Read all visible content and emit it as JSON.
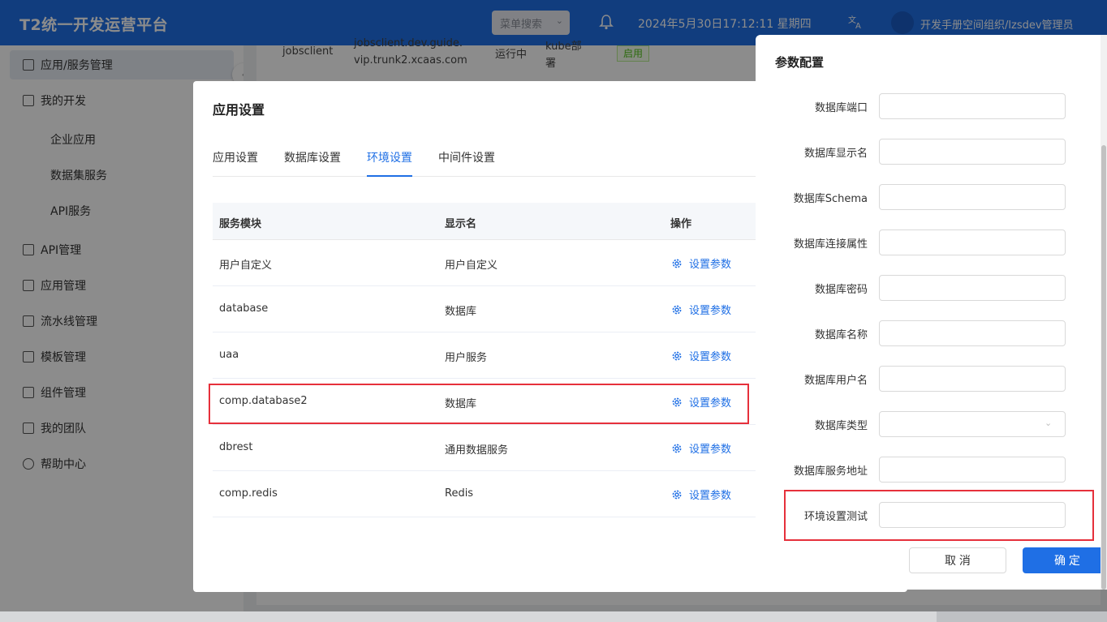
{
  "header": {
    "brand": "T2统一开发运营平台",
    "menu_search": "菜单搜索",
    "datetime": "2024年5月30日17:12:11 星期四",
    "user": "开发手册空间组织/lzsdev管理员"
  },
  "sidebar": {
    "items": [
      {
        "label": "应用/服务管理"
      },
      {
        "label": "我的开发"
      },
      {
        "label": "企业应用"
      },
      {
        "label": "数据集服务"
      },
      {
        "label": "API服务"
      },
      {
        "label": "API管理"
      },
      {
        "label": "应用管理"
      },
      {
        "label": "流水线管理"
      },
      {
        "label": "模板管理"
      },
      {
        "label": "组件管理"
      },
      {
        "label": "我的团队"
      },
      {
        "label": "帮助中心"
      }
    ]
  },
  "background_row": {
    "name": "jobsclient",
    "domain_line1": "jobsclient.dev.guide.",
    "domain_line2": "vip.trunk2.xcaas.com",
    "state": "运行中",
    "deploy_line1": "kube部",
    "deploy_line2": "署",
    "status": "启用"
  },
  "app_dialog": {
    "title": "应用设置",
    "tabs": [
      "应用设置",
      "数据库设置",
      "环境设置",
      "中间件设置"
    ],
    "active_tab": "环境设置",
    "columns": [
      "服务模块",
      "显示名",
      "操作"
    ],
    "rows": [
      {
        "module": "用户自定义",
        "display": "用户自定义",
        "action": "设置参数"
      },
      {
        "module": "database",
        "display": "数据库",
        "action": "设置参数"
      },
      {
        "module": "uaa",
        "display": "用户服务",
        "action": "设置参数"
      },
      {
        "module": "comp.database2",
        "display": "数据库",
        "action": "设置参数"
      },
      {
        "module": "dbrest",
        "display": "通用数据服务",
        "action": "设置参数"
      },
      {
        "module": "comp.redis",
        "display": "Redis",
        "action": "设置参数"
      }
    ]
  },
  "drawer": {
    "title": "参数配置",
    "fields": [
      {
        "label": "数据库端口",
        "value": ""
      },
      {
        "label": "数据库显示名",
        "value": ""
      },
      {
        "label": "数据库Schema",
        "value": ""
      },
      {
        "label": "数据库连接属性",
        "value": ""
      },
      {
        "label": "数据库密码",
        "value": ""
      },
      {
        "label": "数据库名称",
        "value": ""
      },
      {
        "label": "数据库用户名",
        "value": ""
      },
      {
        "label": "数据库类型",
        "value": ""
      },
      {
        "label": "数据库服务地址",
        "value": ""
      },
      {
        "label": "环境设置测试",
        "value": ""
      }
    ],
    "cancel_label": "取 消",
    "ok_label": "确 定"
  },
  "colors": {
    "primary": "#1f6fe5",
    "highlight": "#e6303b"
  }
}
